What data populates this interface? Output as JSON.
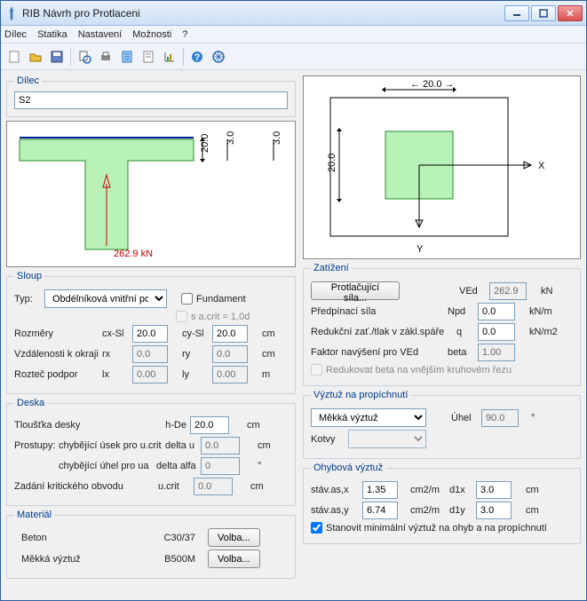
{
  "window": {
    "title": "RIB Návrh pro Protlaceni"
  },
  "menu": [
    "Dílec",
    "Statika",
    "Nastavení",
    "Možnosti",
    "?"
  ],
  "dilec": {
    "legend": "Dílec",
    "value": "S2"
  },
  "diagram_left": {
    "dim_h": "20.0",
    "dim_v1": "3.0",
    "dim_v2": "3.0",
    "force": "262.9 kN"
  },
  "diagram_right": {
    "dim_top": "20.0",
    "dim_left": "20.0",
    "axis_x": "X",
    "axis_y": "Y"
  },
  "sloup": {
    "legend": "Sloup",
    "typ_label": "Typ:",
    "typ_value": "Obdélníková vnitřní po",
    "fundament": "Fundament",
    "s_acrit": "s   a.crit = 1,0d",
    "rozmery": "Rozměry",
    "cx_label": "cx-Sl",
    "cx": "20.0",
    "cy_label": "cy-Sl",
    "cy": "20.0",
    "vzd_label": "Vzdálenosti k okraji",
    "rx_label": "rx",
    "rx": "0.0",
    "ry_label": "ry",
    "ry": "0.0",
    "roztec_label": "Rozteč podpor",
    "lx_label": "lx",
    "lx": "0.00",
    "ly_label": "ly",
    "ly": "0.00",
    "cm": "cm",
    "m": "m"
  },
  "deska": {
    "legend": "Deska",
    "tloustka": "Tloušťka desky",
    "h_label": "h-De",
    "h": "20.0",
    "prostupy": "Prostupy:",
    "chyb_usek": "chybějící úsek pro u.crit",
    "du_label": "delta u",
    "du": "0.0",
    "chyb_uhel": "chybějící úhel pro ua",
    "da_label": "delta alfa",
    "da": "0",
    "zadani": "Zadání kritického obvodu",
    "ucrit_label": "u.crit",
    "ucrit": "0.0",
    "cm": "cm",
    "deg": "°"
  },
  "material": {
    "legend": "Materiál",
    "beton_label": "Beton",
    "beton": "C30/37",
    "vyztuz_label": "Měkká výztuž",
    "vyztuz": "B500M",
    "volba": "Volba..."
  },
  "zatizeni": {
    "legend": "Zatížení",
    "protlac_btn": "Protlačující síla...",
    "ved_label": "VEd",
    "ved": "262.9",
    "ved_unit": "kN",
    "predp": "Předpínací síla",
    "npd_label": "Npd",
    "npd": "0.0",
    "npd_unit": "kN/m",
    "reduk": "Redukční zať./tlak v zákl.spáře",
    "q_label": "q",
    "q": "0.0",
    "q_unit": "kN/m2",
    "faktor": "Faktor navýšení pro VEd",
    "beta_label": "beta",
    "beta": "1.00",
    "reduk_beta": "Redukovat beta na vnějším kruhovém řezu"
  },
  "vyztuz_prop": {
    "legend": "Výztuž na propíchnutí",
    "select": "Měkká výztuž",
    "uhel_label": "Úhel",
    "uhel": "90.0",
    "deg": "°",
    "kotvy_label": "Kotvy",
    "kotvy": ""
  },
  "ohyb": {
    "legend": "Ohybová výztuž",
    "asx_label": "stáv.as,x",
    "asx": "1.35",
    "asy_label": "stáv.as,y",
    "asy": "6.74",
    "unit1": "cm2/m",
    "d1x_label": "d1x",
    "d1x": "3.0",
    "d1y_label": "d1y",
    "d1y": "3.0",
    "cm": "cm",
    "check": "Stanovit minimální výztuž na ohyb a na propíchnutí"
  }
}
